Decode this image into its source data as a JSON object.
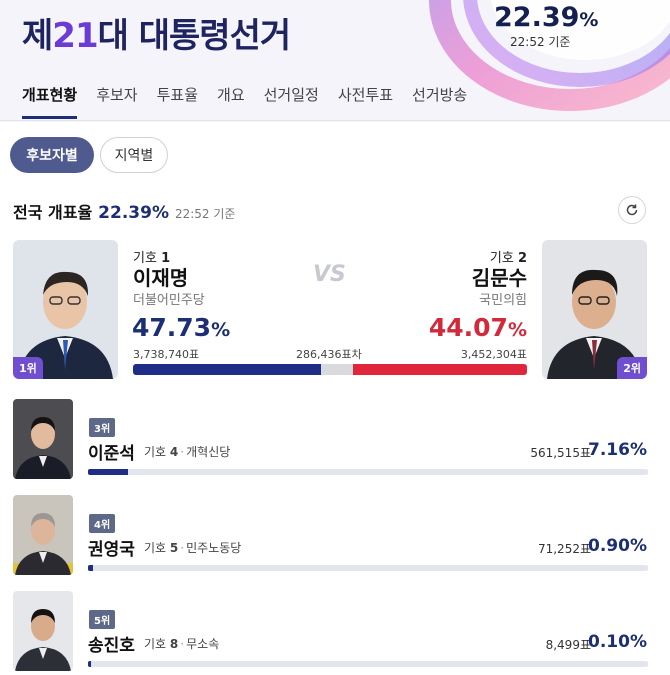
{
  "header": {
    "title_prefix": "제",
    "title_num": "21",
    "title_suffix": "대 대통령선거",
    "count_rate": "22.39",
    "count_rate_unit": "%",
    "count_time": "22:52 기준"
  },
  "tabs": [
    "개표현황",
    "후보자",
    "투표율",
    "개요",
    "선거일정",
    "사전투표",
    "선거방송"
  ],
  "filters": {
    "by_candidate": "후보자별",
    "by_region": "지역별"
  },
  "status": {
    "label": "전국 개표율",
    "rate": "22.39%",
    "time": "22:52 기준"
  },
  "main_race": {
    "vs_label": "VS",
    "gap_votes": "286,436표차",
    "candidate1": {
      "number_label": "기호",
      "number": "1",
      "name": "이재명",
      "party": "더불어민주당",
      "pct": "47.73",
      "votes": "3,738,740표",
      "rank": "1위",
      "color": "#1f2d86"
    },
    "candidate2": {
      "number_label": "기호",
      "number": "2",
      "name": "김문수",
      "party": "국민의힘",
      "pct": "44.07",
      "votes": "3,452,304표",
      "rank": "2위",
      "color": "#e0263a"
    },
    "share_blue": 47.73,
    "share_red": 44.07
  },
  "others": [
    {
      "rank": "3위",
      "name": "이준석",
      "number_label": "기호",
      "number": "4",
      "party": "개혁신당",
      "votes": "561,515표",
      "pct": "7.16%",
      "share": 7.16
    },
    {
      "rank": "4위",
      "name": "권영국",
      "number_label": "기호",
      "number": "5",
      "party": "민주노동당",
      "votes": "71,252표",
      "pct": "0.90%",
      "share": 0.9
    },
    {
      "rank": "5위",
      "name": "송진호",
      "number_label": "기호",
      "number": "8",
      "party": "무소속",
      "votes": "8,499표",
      "pct": "0.10%",
      "share": 0.1
    }
  ],
  "pct_unit": "%",
  "icons": {
    "refresh": "refresh-icon"
  }
}
